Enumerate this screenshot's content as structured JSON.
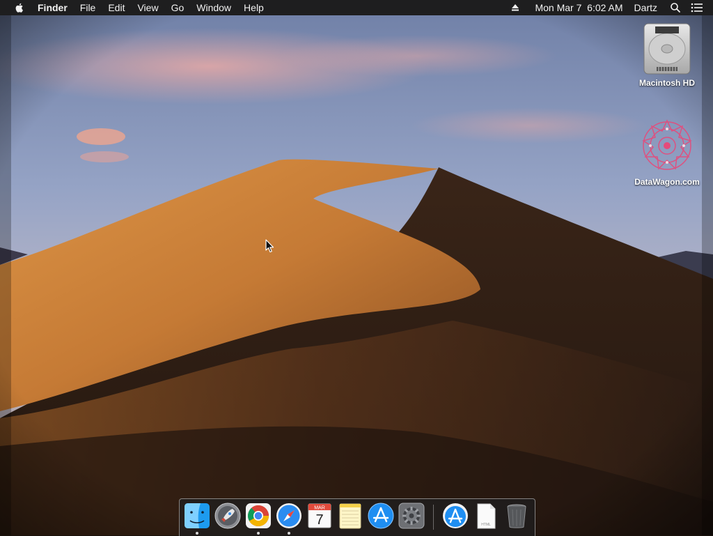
{
  "menubar": {
    "app_name": "Finder",
    "menus": [
      "File",
      "Edit",
      "View",
      "Go",
      "Window",
      "Help"
    ],
    "clock": "Mon Mar 7  6:02 AM",
    "user": "Dartz",
    "icons": [
      "apple-logo-icon",
      "eject-icon",
      "spotlight-search-icon",
      "notification-center-icon"
    ]
  },
  "desktop": {
    "icons": [
      {
        "label": "Macintosh HD",
        "icon": "hard-drive-icon"
      },
      {
        "label": "DataWagon.com",
        "icon": "mandala-image-icon"
      }
    ]
  },
  "dock": {
    "apps": [
      {
        "name": "Finder",
        "icon": "finder-icon",
        "running": true
      },
      {
        "name": "Launchpad",
        "icon": "launchpad-rocket-icon",
        "running": false
      },
      {
        "name": "Google Chrome",
        "icon": "chrome-icon",
        "running": true
      },
      {
        "name": "Safari",
        "icon": "safari-compass-icon",
        "running": true
      },
      {
        "name": "Calendar",
        "icon": "calendar-icon",
        "running": false,
        "month": "MAR",
        "day": "7"
      },
      {
        "name": "Notes",
        "icon": "notes-icon",
        "running": false
      },
      {
        "name": "App Store",
        "icon": "app-store-icon",
        "running": false
      },
      {
        "name": "System Preferences",
        "icon": "gear-icon",
        "running": false
      }
    ],
    "others": [
      {
        "name": "Applications",
        "icon": "applications-folder-icon"
      },
      {
        "name": "Document",
        "icon": "html-document-icon",
        "badge": "HTML"
      },
      {
        "name": "Trash",
        "icon": "trash-icon"
      }
    ]
  },
  "colors": {
    "menubar_bg": "#1e1e1f",
    "sky_top": "#7d8fb2",
    "dune_light": "#d58a3f",
    "dune_shadow": "#2d1d14"
  }
}
